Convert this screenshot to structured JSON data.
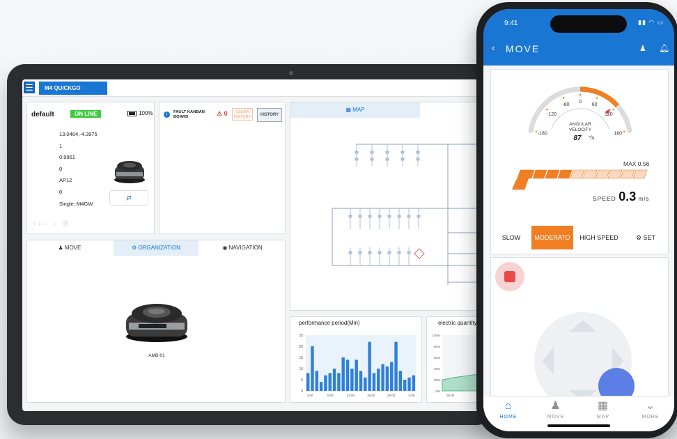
{
  "tablet": {
    "app_tab": "M4 QUICKGO",
    "status": {
      "name": "default",
      "online": "ON LINE",
      "battery": "100%",
      "values": [
        "13.0464,-4.3975",
        "1",
        "0.9961",
        "0",
        "AP12",
        "0",
        "Single::M4GW"
      ]
    },
    "fault": {
      "title": "FAULT KANBAN BOARD",
      "alarm_count": "0",
      "clear_label": "CLEAR HISTORY",
      "history_label": "HISTORY"
    },
    "map": {
      "tab_label": "MAP"
    },
    "nav_tabs": {
      "move": "MOVE",
      "organization": "ORGANIZATION",
      "navigation": "NAVIGATION"
    },
    "robot_label": "AMB-01",
    "performance_title": "performance period(Min)",
    "electric_title": "electric quantity(%"
  },
  "chart_data": [
    {
      "type": "bar",
      "title": "performance period(Min)",
      "ylim": [
        0,
        25
      ],
      "yticks": [
        "0",
        "5",
        "10",
        "15",
        "20",
        "25"
      ],
      "xticks": [
        "4:00",
        "8:00",
        "12:00",
        "16:00",
        "20:00",
        "0:00"
      ],
      "values": [
        8,
        20,
        9,
        4,
        7,
        8,
        10,
        8,
        15,
        14,
        10,
        14,
        9,
        6,
        22,
        8,
        10,
        12,
        11,
        13,
        22,
        9,
        5,
        6,
        7
      ],
      "color": "#2f80d8"
    },
    {
      "type": "area",
      "title": "electric quantity(%",
      "ylim": [
        0,
        100
      ],
      "yticks": [
        "0%",
        "20%",
        "40%",
        "60%",
        "80%",
        "100%"
      ],
      "xticks": [
        "00:00"
      ],
      "values": [
        20,
        24,
        27,
        30,
        32
      ],
      "color": "#7fd0a8"
    }
  ],
  "phone": {
    "time": "9:41",
    "title": "MOVE",
    "gauge": {
      "ticks": [
        "-180",
        "-120",
        "-60",
        "0",
        "60",
        "120",
        "180"
      ],
      "label": "ANGULAR VELOCITY",
      "value": "87",
      "unit": "°/s"
    },
    "max_label": "MAX 0.56",
    "speed_prefix": "SPEED",
    "speed_value": "0.3",
    "speed_unit": "m/s",
    "modes": [
      "SLOW",
      "MODERATO",
      "HIGH SPEED",
      "SET"
    ],
    "nav": [
      "HOME",
      "MOVE",
      "MAP",
      "MORE"
    ],
    "colors": {
      "brand": "#1976d2",
      "accent": "#f07f24"
    }
  }
}
